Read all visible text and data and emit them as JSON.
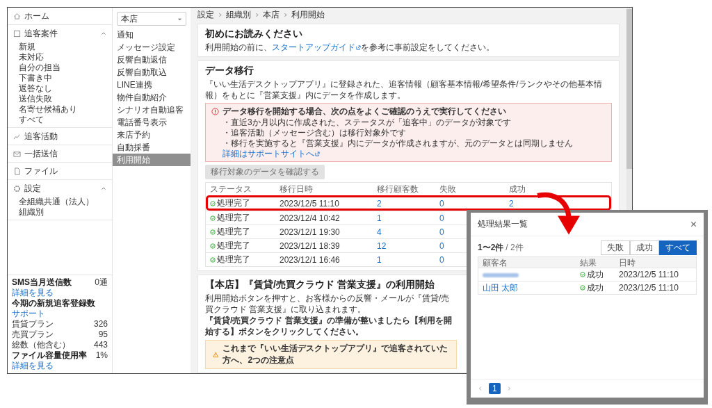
{
  "nav": {
    "items": [
      {
        "label": "ホーム"
      },
      {
        "label": "追客案件",
        "expanded": true,
        "children": [
          {
            "label": "新規"
          },
          {
            "label": "未対応"
          },
          {
            "label": "自分の担当"
          },
          {
            "label": "下書き中"
          },
          {
            "label": "返答なし"
          },
          {
            "label": "送信失敗"
          },
          {
            "label": "名寄せ候補あり"
          },
          {
            "label": "すべて"
          }
        ]
      },
      {
        "label": "追客活動"
      },
      {
        "label": "一括送信"
      },
      {
        "label": "ファイル"
      },
      {
        "label": "設定",
        "expanded": true,
        "children": [
          {
            "label": "全組織共通（法人）"
          },
          {
            "label": "組織別"
          }
        ]
      }
    ]
  },
  "stats": [
    {
      "kind": "heading",
      "label": "SMS当月送信数",
      "link": "詳細を見る",
      "value": "0通"
    },
    {
      "kind": "heading",
      "label": "今期の新規追客登録数",
      "link": "サポート"
    },
    {
      "kind": "item",
      "label": "賃貸プラン",
      "value": "326"
    },
    {
      "kind": "item",
      "label": "売買プラン",
      "value": "95"
    },
    {
      "kind": "item",
      "label": "総数（他含む）",
      "value": "443"
    },
    {
      "kind": "heading",
      "label": "ファイル容量使用率",
      "link": "詳細を見る",
      "value": "1%"
    }
  ],
  "submenu": {
    "store": "本店",
    "items": [
      {
        "label": "通知",
        "selected": false
      },
      {
        "label": "メッセージ設定",
        "selected": false
      },
      {
        "label": "反響自動返信",
        "selected": false
      },
      {
        "label": "反響自動取込",
        "selected": false
      },
      {
        "label": "LINE連携",
        "selected": false
      },
      {
        "label": "物件自動紹介",
        "selected": false
      },
      {
        "label": "シナリオ自動追客",
        "selected": false
      },
      {
        "label": "電話番号表示",
        "selected": false
      },
      {
        "label": "来店予約",
        "selected": false
      },
      {
        "label": "自動採番",
        "selected": false
      },
      {
        "label": "利用開始",
        "selected": true
      }
    ]
  },
  "breadcrumb": [
    "設定",
    "組織別",
    "本店",
    "利用開始"
  ],
  "intro": {
    "title": "初めにお読みください",
    "before": "利用開始の前に、",
    "link": "スタートアップガイド",
    "after": "を参考に事前設定をしてください。"
  },
  "migration": {
    "title": "データ移行",
    "description": "『いい生活デスクトップアプリ』に登録された、追客情報（顧客基本情報/希望条件/ランクやその他基本情報）をもとに『営業支援』内にデータを作成します。",
    "alert": {
      "title": "データ移行を開始する場合、次の点をよくご確認のうえで実行してください",
      "bullets": [
        "・直近3か月以内に作成された、ステータスが「追客中」のデータが対象です",
        "・追客活動（メッセージ含む）は移行対象外です",
        "・移行を実施すると『営業支援』内にデータが作成されますが、元のデータとは同期しません"
      ],
      "link": "詳細はサポートサイトへ"
    },
    "button": {
      "label": "移行対象のデータを確認する",
      "disabled": true
    },
    "columns": [
      "ステータス",
      "移行日時",
      "移行顧客数",
      "失敗",
      "成功"
    ],
    "rows": [
      {
        "status": "処理完了",
        "date": "2023/12/5 11:10",
        "count": "2",
        "failed": "0",
        "success": "2",
        "highlighted": true
      },
      {
        "status": "処理完了",
        "date": "2023/12/4 10:42",
        "count": "1",
        "failed": "0",
        "highlighted": false
      },
      {
        "status": "処理完了",
        "date": "2023/12/1 19:30",
        "count": "4",
        "failed": "0",
        "highlighted": false
      },
      {
        "status": "処理完了",
        "date": "2023/12/1 18:39",
        "count": "12",
        "failed": "0",
        "highlighted": false
      },
      {
        "status": "処理完了",
        "date": "2023/12/1 16:46",
        "count": "1",
        "failed": "0",
        "highlighted": false
      }
    ]
  },
  "start": {
    "title": "【本店】『賃貸/売買クラウド 営業支援』の利用開始",
    "line1": "利用開始ボタンを押すと、お客様からの反響・メールが『賃貸/売買クラウド 営業支援』に取り込まれます。",
    "line2": "『賃貸/売買クラウド 営業支援』の準備が整いましたら【利用を開始する】ボタンをクリックしてください。",
    "warning": "これまで『いい生活デスクトップアプリ』で追客されていた方へ、2つの注意点"
  },
  "dialog": {
    "title": "処理結果一覧",
    "range": "1〜2件",
    "total": "/ 2件",
    "filters": [
      {
        "label": "失敗",
        "selected": false
      },
      {
        "label": "成功",
        "selected": false
      },
      {
        "label": "すべて",
        "selected": true
      }
    ],
    "columns": [
      "顧客名",
      "結果",
      "日時"
    ],
    "rows": [
      {
        "name": "",
        "redacted": true,
        "result": "成功",
        "date": "2023/12/5 11:10"
      },
      {
        "name": "山田 太郎",
        "redacted": false,
        "result": "成功",
        "date": "2023/12/5 11:10"
      }
    ],
    "pages": [
      {
        "label": "1",
        "selected": true
      }
    ]
  }
}
